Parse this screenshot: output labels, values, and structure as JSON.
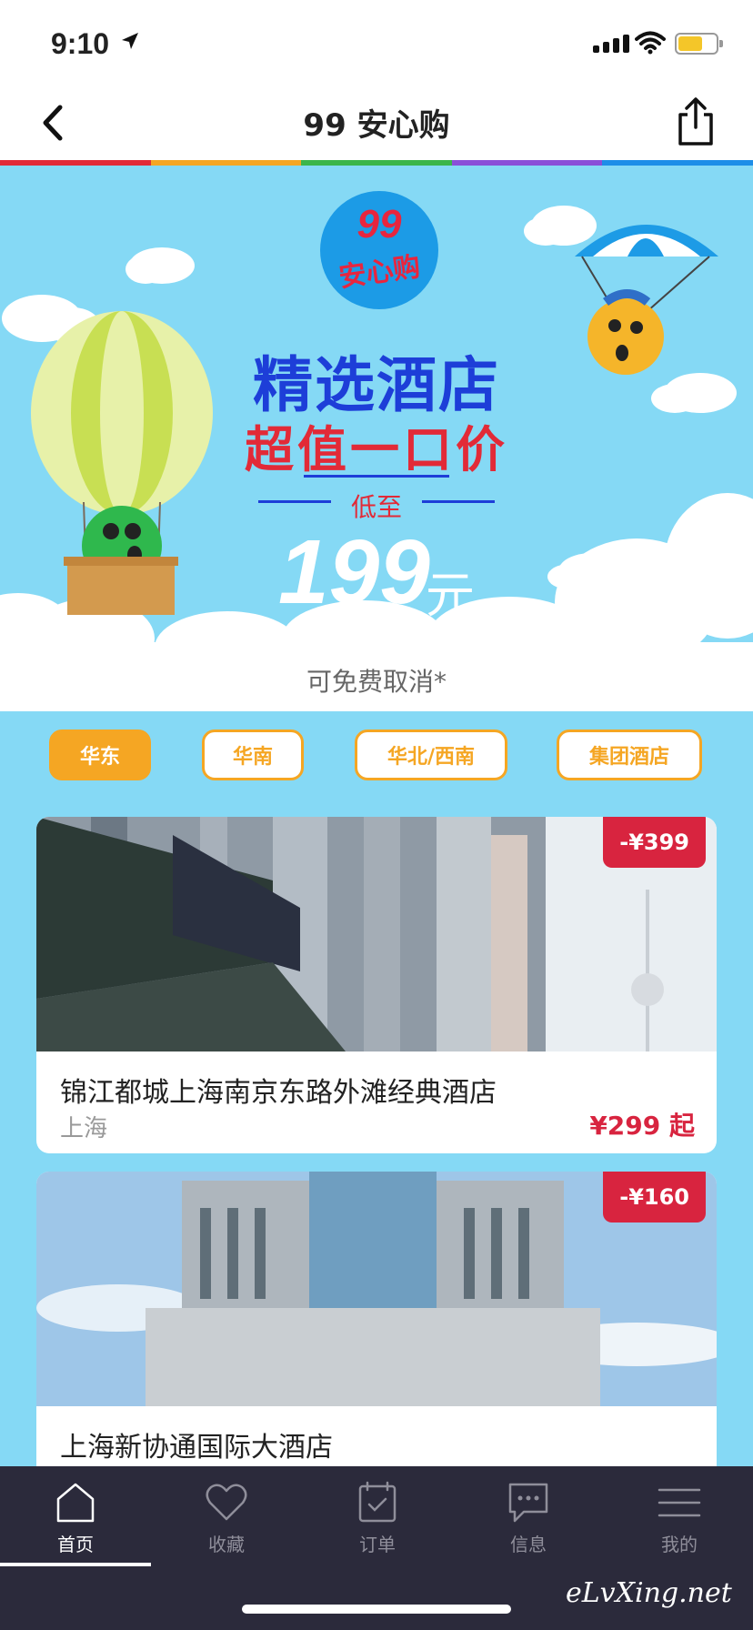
{
  "status_bar": {
    "time": "9:10"
  },
  "nav": {
    "title": "99 安心购"
  },
  "banner": {
    "logo_number": "99",
    "logo_text": "安心购",
    "headline": "精选酒店",
    "subheadline": "超值一口价",
    "as_low_as": "低至",
    "price": "199",
    "price_unit": "元",
    "note": "可免费取消*"
  },
  "filters": [
    {
      "label": "华东",
      "active": true
    },
    {
      "label": "华南",
      "active": false
    },
    {
      "label": "华北/西南",
      "active": false
    },
    {
      "label": "集团酒店",
      "active": false
    }
  ],
  "hotels": [
    {
      "name": "锦江都城上海南京东路外滩经典酒店",
      "city": "上海",
      "price": "¥299 起",
      "discount": "-¥399"
    },
    {
      "name": "上海新协通国际大酒店",
      "discount": "-¥160"
    }
  ],
  "tabs": [
    {
      "label": "首页",
      "icon": "home-icon",
      "active": true
    },
    {
      "label": "收藏",
      "icon": "heart-icon",
      "active": false
    },
    {
      "label": "订单",
      "icon": "calendar-icon",
      "active": false
    },
    {
      "label": "信息",
      "icon": "message-icon",
      "active": false
    },
    {
      "label": "我的",
      "icon": "menu-icon",
      "active": false
    }
  ],
  "watermark": "eLvXing.net",
  "colors": {
    "accent": "#f5a623",
    "price_red": "#d8243f",
    "banner_sky": "#85d9f5",
    "tabbar_bg": "#2b2a3b",
    "headline_blue": "#1d3ed8"
  }
}
